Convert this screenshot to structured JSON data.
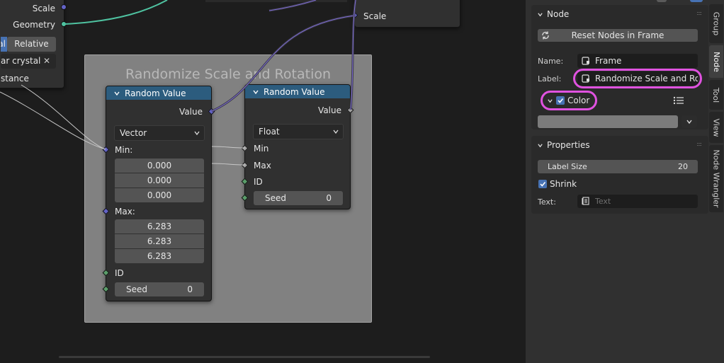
{
  "top_left_node": {
    "scale_label": "Scale",
    "geometry_label": "Geometry",
    "mode_left": "al",
    "mode_right": "Relative",
    "object_value": "ar crystal",
    "distance_label": "stance"
  },
  "top_right_node": {
    "scale_label": "Scale"
  },
  "frame": {
    "title": "Randomize Scale and Rotation"
  },
  "random_value_vector": {
    "title": "Random Value",
    "output_value": "Value",
    "data_type": "Vector",
    "min_label": "Min:",
    "min_values": [
      "0.000",
      "0.000",
      "0.000"
    ],
    "max_label": "Max:",
    "max_values": [
      "6.283",
      "6.283",
      "6.283"
    ],
    "id_label": "ID",
    "seed_label": "Seed",
    "seed_value": "0"
  },
  "random_value_float": {
    "title": "Random Value",
    "output_value": "Value",
    "data_type": "Float",
    "min_label": "Min",
    "max_label": "Max",
    "id_label": "ID",
    "seed_label": "Seed",
    "seed_value": "0"
  },
  "sidebar": {
    "node_panel": {
      "title": "Node",
      "reset_button": "Reset Nodes in Frame",
      "name_label": "Name:",
      "name_value": "Frame",
      "label_label": "Label:",
      "label_value": "Randomize Scale and Ro...",
      "color_label": "Color"
    },
    "properties_panel": {
      "title": "Properties",
      "label_size_label": "Label Size",
      "label_size_value": "20",
      "shrink_label": "Shrink",
      "text_label": "Text:",
      "text_placeholder": "Text"
    },
    "tabs": [
      "Group",
      "Node",
      "Tool",
      "View",
      "Node Wrangler"
    ],
    "active_tab": "Node"
  },
  "colors": {
    "node_header": "#2c5c7e",
    "frame_bg": "#818181",
    "highlight": "#e052e0",
    "checkbox": "#4772b3",
    "wire_geometry": "#4fc3a1",
    "wire_vector": "#6363c7"
  }
}
